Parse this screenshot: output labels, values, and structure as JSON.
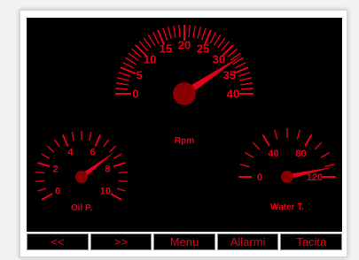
{
  "colors": {
    "accent": "#e3001a",
    "needle_hub": "#8a0000",
    "screen_bg": "#000000"
  },
  "gauges": {
    "rpm": {
      "label": "Rpm",
      "min": 0,
      "max": 40,
      "tick_labels": [
        "0",
        "5",
        "10",
        "15",
        "20",
        "25",
        "30",
        "35",
        "40"
      ],
      "value": 32.5
    },
    "oil": {
      "label": "Oil P.",
      "min": 0,
      "max": 10,
      "tick_labels": [
        "0",
        "2",
        "4",
        "6",
        "8",
        "10"
      ],
      "value": 7.2
    },
    "water": {
      "label": "Water T.",
      "min": 0,
      "max": 120,
      "tick_labels": [
        "0",
        "40",
        "80",
        "120"
      ],
      "value": 112
    }
  },
  "buttons": [
    {
      "name": "prev-button",
      "label": "<<"
    },
    {
      "name": "next-button",
      "label": ">>"
    },
    {
      "name": "menu-button",
      "label": "Menu"
    },
    {
      "name": "alarms-button",
      "label": "Allarmi"
    },
    {
      "name": "silence-button",
      "label": "Tacita"
    }
  ]
}
